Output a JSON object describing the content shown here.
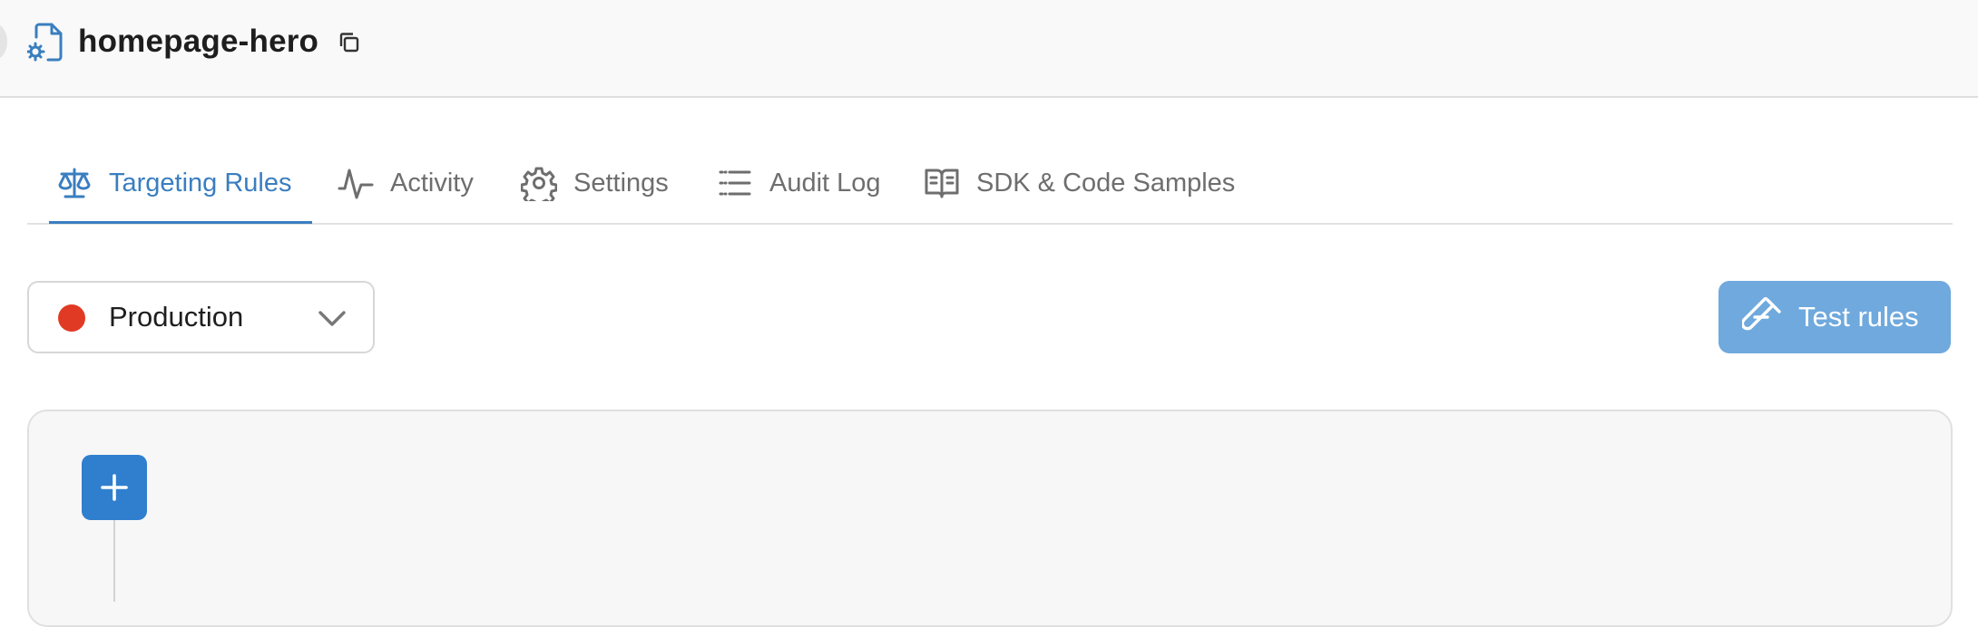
{
  "header": {
    "flag_name": "homepage-hero",
    "file_icon": "file-settings-icon",
    "copy_icon": "copy-icon"
  },
  "tabs": [
    {
      "label": "Targeting Rules",
      "icon": "scale-icon",
      "active": true
    },
    {
      "label": "Activity",
      "icon": "activity-icon",
      "active": false
    },
    {
      "label": "Settings",
      "icon": "gear-icon",
      "active": false
    },
    {
      "label": "Audit Log",
      "icon": "list-icon",
      "active": false
    },
    {
      "label": "SDK & Code Samples",
      "icon": "book-icon",
      "active": false
    }
  ],
  "environment": {
    "selected": "Production",
    "status_color": "#e03a24"
  },
  "actions": {
    "test_rules_label": "Test rules",
    "test_rules_icon": "test-tube-icon",
    "add_rule_icon": "plus-icon"
  },
  "colors": {
    "accent": "#3a7ebf",
    "button_primary": "#2f7fce",
    "button_disabled": "#6fa9dd"
  }
}
